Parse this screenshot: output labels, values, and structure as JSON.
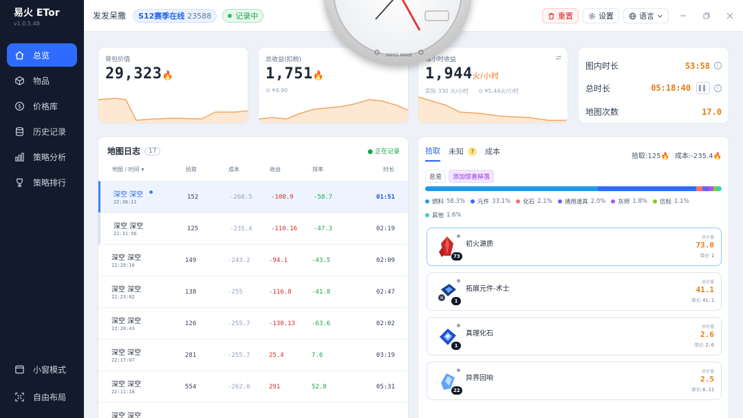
{
  "app": {
    "title": "易火 ETor",
    "version": "v1.0.5.48"
  },
  "sidebar": {
    "items": [
      {
        "label": "总览",
        "icon": "home-icon",
        "active": true
      },
      {
        "label": "物品",
        "icon": "box-icon"
      },
      {
        "label": "价格库",
        "icon": "dollar-icon"
      },
      {
        "label": "历史记录",
        "icon": "database-icon"
      },
      {
        "label": "策略分析",
        "icon": "bar-chart-icon"
      },
      {
        "label": "策略排行",
        "icon": "trophy-icon"
      }
    ],
    "bottom": [
      {
        "label": "小窗模式",
        "icon": "window-icon"
      },
      {
        "label": "自由布局",
        "icon": "layout-icon"
      }
    ]
  },
  "topbar": {
    "user": "发发呆撒",
    "season_label": "S12赛季在线",
    "season_count": "23588",
    "recording_label": "记录中",
    "reset_label": "重置",
    "settings_label": "设置",
    "language_label": "语言"
  },
  "stats": {
    "bag_value": {
      "label": "背包价值",
      "value": "29,323"
    },
    "total_income": {
      "label": "总收益(扣税)",
      "value": "1,751",
      "sub": "¥4.90"
    },
    "hourly": {
      "label": "每小时收益",
      "value": "1,944",
      "unit": "火/小时",
      "sub_actual": "实际 330 火/小时",
      "sub_money": "¥5.44火/小时"
    }
  },
  "timers": {
    "map_time_label": "图内时长",
    "map_time": "53:58",
    "total_time_label": "总时长",
    "total_time": "05:18:40",
    "map_count_label": "地图次数",
    "map_count": "17.0"
  },
  "log": {
    "title": "地图日志",
    "count": "17",
    "recording": "正在记录",
    "columns": {
      "map": "地图 / 时间 ▾",
      "pick": "拾取",
      "cost": "成本",
      "income": "收益",
      "eff": "效率",
      "dur": "时长"
    },
    "rows": [
      {
        "name": "深空 深空",
        "time": "22:36:11",
        "pick": "152",
        "cost": "-260.5",
        "income": "-108.9",
        "eff": "-58.7",
        "dur": "01:51"
      },
      {
        "name": "深空 深空",
        "time": "22:31:56",
        "pick": "125",
        "cost": "-235.4",
        "income": "-110.16",
        "eff": "-47.3",
        "dur": "02:19"
      },
      {
        "name": "深空 深空",
        "time": "22:29:10",
        "pick": "149",
        "cost": "-243.2",
        "income": "-94.1",
        "eff": "-43.5",
        "dur": "02:09"
      },
      {
        "name": "深空 深空",
        "time": "22:23:02",
        "pick": "138",
        "cost": "-255",
        "income": "-116.8",
        "eff": "-41.8",
        "dur": "02:47"
      },
      {
        "name": "深空 深空",
        "time": "22:20:43",
        "pick": "126",
        "cost": "-255.7",
        "income": "-130.13",
        "eff": "-63.6",
        "dur": "02:02"
      },
      {
        "name": "深空 深空",
        "time": "22:17:07",
        "pick": "281",
        "cost": "-255.7",
        "income": "25.4",
        "eff": "7.6",
        "dur": "03:19"
      },
      {
        "name": "深空 深空",
        "time": "22:11:18",
        "pick": "554",
        "cost": "-262.8",
        "income": "291",
        "eff": "52.8",
        "dur": "05:31"
      },
      {
        "name": "深空 深空",
        "time": "",
        "pick": "",
        "cost": "",
        "income": "",
        "eff": "",
        "dur": ""
      }
    ]
  },
  "drops": {
    "tabs": {
      "pick": "拾取",
      "unknown": "未知",
      "unknown_count": "7",
      "cost": "成本"
    },
    "summary": {
      "pick_label": "拾取:125",
      "cost_label": "成本:-235.4"
    },
    "sub_tabs": {
      "overview": "总览",
      "add_favorite": "添加惊喜掉落"
    },
    "legend": [
      {
        "label": "燃料",
        "pct": "58.3%",
        "color": "#1e9be8"
      },
      {
        "label": "元件",
        "pct": "33.1%",
        "color": "#2f6bff"
      },
      {
        "label": "化石",
        "pct": "2.1%",
        "color": "#f87171"
      },
      {
        "label": "通用道具",
        "pct": "2.0%",
        "color": "#6d5df5"
      },
      {
        "label": "灰烬",
        "pct": "1.8%",
        "color": "#a855f7"
      },
      {
        "label": "信标",
        "pct": "1.1%",
        "color": "#84cc16"
      },
      {
        "label": "其他",
        "pct": "1.6%",
        "color": "#2dd4bf"
      }
    ],
    "total_label": "总价值",
    "unit_label": "单价",
    "items": [
      {
        "name": "初火源质",
        "qty": "73",
        "total": "73.0",
        "unit": "1"
      },
      {
        "name": "拓展元件-术士",
        "qty": "1",
        "total": "41.1",
        "unit": "41.1"
      },
      {
        "name": "真理化石",
        "qty": "1",
        "total": "2.6",
        "unit": "2.6"
      },
      {
        "name": "异界回响",
        "qty": "22",
        "total": "2.5",
        "unit": "0.11"
      }
    ]
  }
}
